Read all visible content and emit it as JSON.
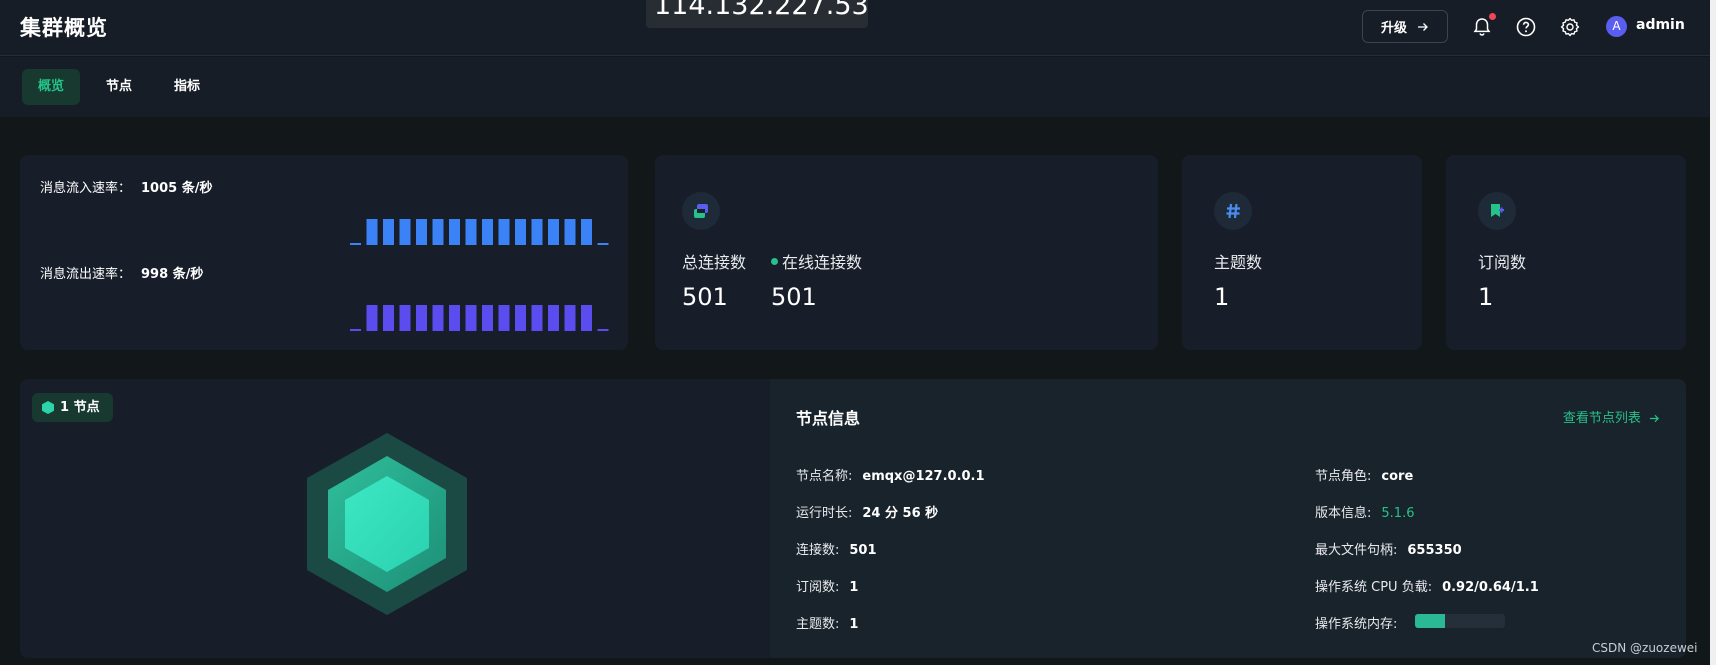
{
  "header": {
    "title": "集群概览",
    "ip_overlay": "114.132.227.53",
    "upgrade_label": "升级",
    "user_initial": "A",
    "username": "admin"
  },
  "tabs": [
    {
      "label": "概览",
      "active": true
    },
    {
      "label": "节点",
      "active": false
    },
    {
      "label": "指标",
      "active": false
    }
  ],
  "rates": {
    "incoming_label": "消息流入速率：",
    "incoming_value": "1005 条/秒",
    "incoming_color": "#3b82f6",
    "outgoing_label": "消息流出速率：",
    "outgoing_value": "998 条/秒",
    "outgoing_color": "#5b4cf0"
  },
  "connections": {
    "total_label": "总连接数",
    "total_value": "501",
    "online_label": "在线连接数",
    "online_value": "501",
    "icon": "connections-icon"
  },
  "topics": {
    "label": "主题数",
    "value": "1",
    "icon": "hash-icon"
  },
  "subscriptions": {
    "label": "订阅数",
    "value": "1",
    "icon": "subscription-flag-icon"
  },
  "node": {
    "badge_label": "1 节点",
    "section_title": "节点信息",
    "view_link": "查看节点列表",
    "name_label": "节点名称:",
    "name_value": "emqx@127.0.0.1",
    "uptime_label": "运行时长:",
    "uptime_value": "24 分 56 秒",
    "connections_label": "连接数:",
    "connections_value": "501",
    "subscriptions_label": "订阅数:",
    "subscriptions_value": "1",
    "topics_label": "主题数:",
    "topics_value": "1",
    "role_label": "节点角色:",
    "role_value": "core",
    "version_label": "版本信息:",
    "version_value": "5.1.6",
    "max_fd_label": "最大文件句柄:",
    "max_fd_value": "655350",
    "cpu_label": "操作系统 CPU 负载:",
    "cpu_value": "0.92/0.64/1.1",
    "memory_label": "操作系统内存:",
    "memory_fraction": 0.33
  },
  "colors": {
    "accent": "#25c28a",
    "background": "#121719",
    "card": "#171e29"
  },
  "watermark": "CSDN @zuozewei"
}
